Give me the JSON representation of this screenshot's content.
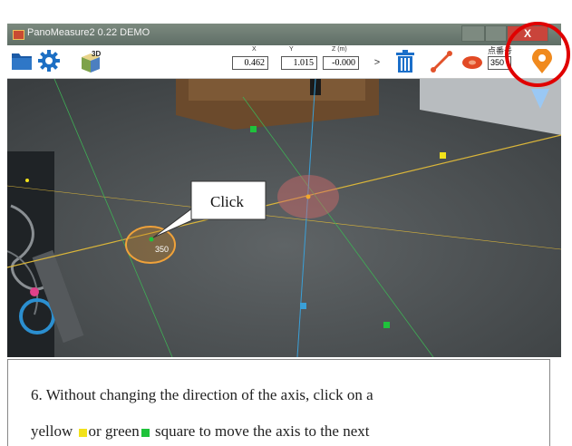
{
  "window": {
    "title": "PanoMeasure2 0.22 DEMO",
    "close_label": "X"
  },
  "toolbar": {
    "x_label": "X",
    "y_label": "Y",
    "z_label": "Z (m)",
    "x_value": "0.462",
    "y_value": "1.015",
    "z_value": "-0.000",
    "expand_label": ">",
    "point_no_label": "点番号",
    "point_no_value": "350",
    "cube_label": "3D",
    "icons": [
      "folder-icon",
      "gear-icon",
      "cube-3d-icon",
      "trash-icon",
      "line-tool-icon",
      "tape-measure-icon",
      "map-pin-icon"
    ]
  },
  "scene": {
    "callout_label": "Click",
    "point_label": "350"
  },
  "caption": {
    "line1": "6. Without changing the direction of the axis, click on a",
    "line2_a": "yellow ",
    "line2_b": "or green",
    "line2_c": " square to move the axis to the next"
  },
  "colors": {
    "highlight": "#e00000",
    "yellow_square": "#f2e21a",
    "green_square": "#1fc23b",
    "axis_x": "#d9b53a",
    "axis_green": "#3fae55",
    "axis_blue": "#3aa0d8"
  }
}
